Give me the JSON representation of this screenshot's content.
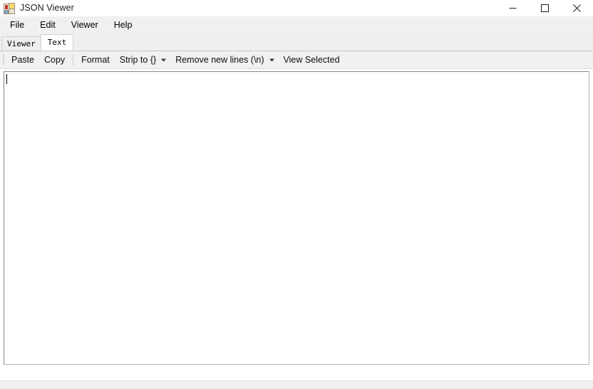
{
  "window": {
    "title": "JSON Viewer",
    "icon": "app-icon",
    "caption_buttons": {
      "minimize": "minimize-icon",
      "maximize": "maximize-icon",
      "close": "close-icon"
    }
  },
  "menubar": {
    "items": [
      {
        "label": "File"
      },
      {
        "label": "Edit"
      },
      {
        "label": "Viewer"
      },
      {
        "label": "Help"
      }
    ]
  },
  "tabs": {
    "selected": "Text",
    "items": [
      {
        "label": "Viewer",
        "selected": false
      },
      {
        "label": "Text",
        "selected": true
      }
    ]
  },
  "toolbar": {
    "grip": "drag-grip-icon",
    "paste_label": "Paste",
    "copy_label": "Copy",
    "format_label": "Format",
    "strip_label": "Strip to {}",
    "strip_caret": "chevron-down-icon",
    "remove_newlines_label": "Remove new lines (\\n)",
    "remove_newlines_caret": "chevron-down-icon",
    "view_selected_label": "View Selected"
  },
  "editor": {
    "value": "",
    "placeholder": ""
  },
  "statusbar": {
    "text": ""
  },
  "colors": {
    "window_bg": "#ffffff",
    "chrome_bg": "#f0f0f0",
    "toolbar_bg": "#f1f1f1",
    "tab_selected_bg": "#ffffff",
    "tab_unselected_bg": "#eeeeee",
    "border": "#cfcfcf",
    "text": "#000000"
  }
}
